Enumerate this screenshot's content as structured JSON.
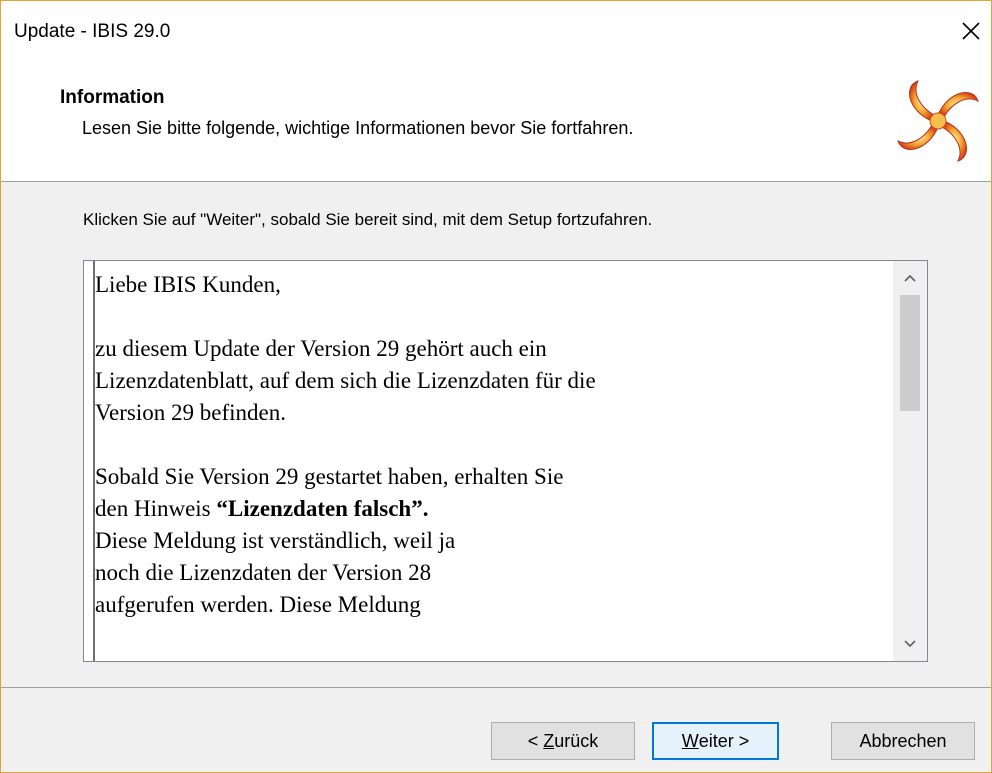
{
  "window": {
    "title": "Update - IBIS 29.0"
  },
  "header": {
    "title": "Information",
    "subtitle": "Lesen Sie bitte folgende, wichtige Informationen bevor Sie fortfahren."
  },
  "content": {
    "instruction": "Klicken Sie auf \"Weiter\", sobald Sie bereit sind, mit dem Setup fortzufahren.",
    "info_lines": {
      "l1": "Liebe IBIS Kunden,",
      "l2": "zu diesem Update der Version 29 gehört auch ein",
      "l3": "Lizenzdatenblatt, auf dem sich die Lizenzdaten für die",
      "l4": "Version 29 befinden.",
      "l5": "Sobald Sie Version 29 gestartet haben, erhalten Sie",
      "l6_prefix": "den Hinweis ",
      "l6_bold": "“Lizenzdaten falsch”.",
      "l7": "Diese Meldung ist verständlich, weil ja",
      "l8": "noch die Lizenzdaten der Version 28",
      "l9": "aufgerufen werden. Diese Meldung"
    }
  },
  "buttons": {
    "back_prefix": "< ",
    "back_accel": "Z",
    "back_rest": "urück",
    "next_accel": "W",
    "next_rest": "eiter >",
    "cancel": "Abbrechen"
  },
  "icons": {
    "close": "close-icon",
    "logo": "ibis-logo-icon",
    "scroll_up": "chevron-up-icon",
    "scroll_down": "chevron-down-icon"
  },
  "colors": {
    "window_border": "#e3a436",
    "focus_border": "#0078d7",
    "logo_red": "#d43a1a",
    "logo_orange": "#f2a12b"
  }
}
